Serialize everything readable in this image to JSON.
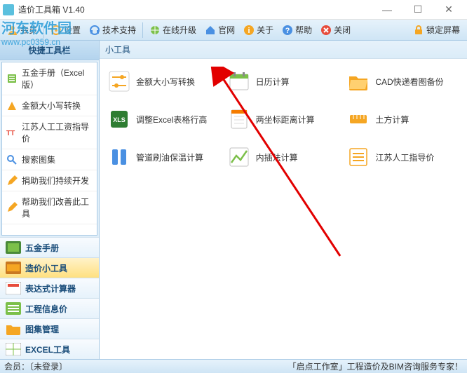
{
  "window": {
    "title": "造价工具箱 V1.40"
  },
  "titlebar_buttons": {
    "min": "—",
    "max": "☐",
    "close": "✕"
  },
  "toolbar": {
    "member": "会员",
    "settings": "设置",
    "techsupport": "技术支持",
    "upgrade": "在线升级",
    "official": "官网",
    "about": "关于",
    "help": "帮助",
    "close": "关闭",
    "lock": "锁定屏幕"
  },
  "watermark": {
    "line1": "河东软件园",
    "line2": "www.pc0359.cn"
  },
  "sidebar": {
    "title": "快捷工具栏",
    "links": [
      {
        "label": "五金手册（Excel版）"
      },
      {
        "label": "金额大小写转换"
      },
      {
        "label": "江苏人工工资指导价"
      },
      {
        "label": "搜索图集"
      },
      {
        "label": "捐助我们持续开发"
      },
      {
        "label": "帮助我们改善此工具"
      }
    ],
    "nav": [
      {
        "label": "五金手册"
      },
      {
        "label": "造价小工具"
      },
      {
        "label": "表达式计算器"
      },
      {
        "label": "工程信息价"
      },
      {
        "label": "图集管理"
      },
      {
        "label": "EXCEL工具"
      }
    ]
  },
  "main": {
    "title": "小工具",
    "tools": [
      {
        "label": "金额大小写转换"
      },
      {
        "label": "日历计算"
      },
      {
        "label": "CAD快递看图备份"
      },
      {
        "label": "调整Excel表格行高"
      },
      {
        "label": "两坐标距离计算"
      },
      {
        "label": "土方计算"
      },
      {
        "label": "管道刷油保温计算"
      },
      {
        "label": "内插法计算"
      },
      {
        "label": "江苏人工指导价"
      }
    ]
  },
  "status": {
    "left": "会员：〔未登录〕",
    "right": "「启点工作室」工程造价及BIM咨询服务专家！"
  }
}
